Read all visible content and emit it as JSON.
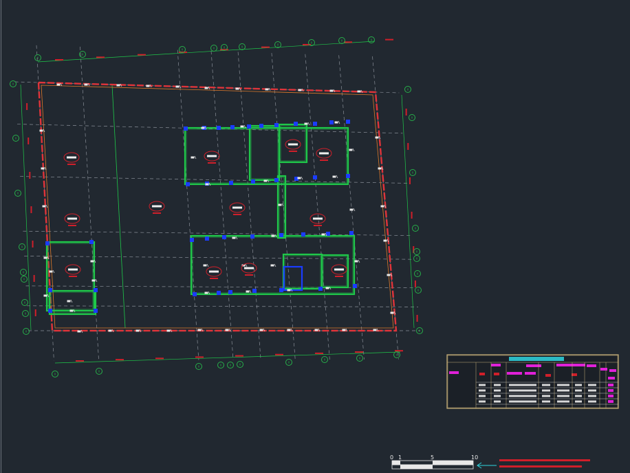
{
  "colors": {
    "background": "#212830",
    "grid": "#8a9099",
    "bubble": "#27b04a",
    "wall": "#1fc94a",
    "outer_wall": "#e0343a",
    "column": "#1a3cff",
    "table_border": "#c9b27a",
    "table_title": "#2fd6e0",
    "magenta": "#e020d8",
    "note_red": "#d01f2a"
  },
  "scale_bar": {
    "ticks": [
      "0",
      "1",
      "5",
      "10"
    ]
  }
}
